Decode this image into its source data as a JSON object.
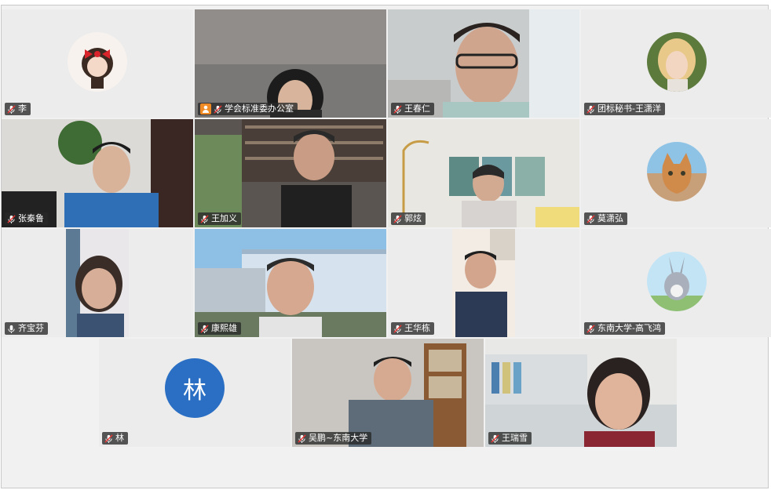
{
  "participants": [
    {
      "name": "李",
      "kind": "avatar",
      "mic": "muted"
    },
    {
      "name": "学会标准委办公室",
      "kind": "video",
      "mic": "muted",
      "host": true
    },
    {
      "name": "王春仁",
      "kind": "video",
      "mic": "muted"
    },
    {
      "name": "团标秘书-王潇洋",
      "kind": "avatar",
      "mic": "muted"
    },
    {
      "name": "张秦鲁",
      "kind": "video",
      "mic": "muted"
    },
    {
      "name": "王加义",
      "kind": "video",
      "mic": "muted"
    },
    {
      "name": "郭炫",
      "kind": "video",
      "mic": "muted"
    },
    {
      "name": "莫潇弘",
      "kind": "avatar",
      "mic": "muted"
    },
    {
      "name": "齐宝芬",
      "kind": "video",
      "mic": "active"
    },
    {
      "name": "康熙雄",
      "kind": "video",
      "mic": "muted"
    },
    {
      "name": "王华栋",
      "kind": "video",
      "mic": "muted"
    },
    {
      "name": "东南大学-高飞鸿",
      "kind": "avatar",
      "mic": "muted"
    },
    {
      "name": "林",
      "kind": "letter",
      "mic": "muted",
      "letter": "林"
    },
    {
      "name": "吴鹏~东南大学",
      "kind": "video",
      "mic": "muted"
    },
    {
      "name": "王瑞雪",
      "kind": "video",
      "mic": "muted"
    }
  ],
  "icons": {
    "mic_muted": "mic-muted-icon",
    "mic_active": "mic-icon",
    "host": "host-icon"
  },
  "colors": {
    "name_tag_bg": "#282828",
    "letter_avatar_bg": "#2a6fc4",
    "host_badge": "#f08a24"
  }
}
